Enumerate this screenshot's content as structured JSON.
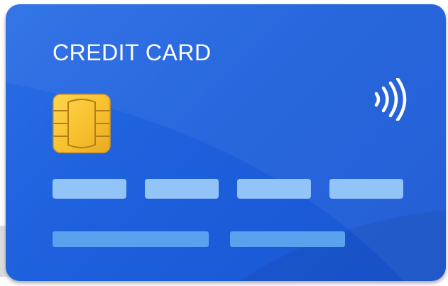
{
  "card": {
    "title": "CREDIT CARD",
    "colors": {
      "card_background": "#1d5fdc",
      "chip_gold": "#f6c33a",
      "number_bar": "#93c4f7",
      "detail_bar": "#5aa2ee",
      "text": "#ffffff"
    },
    "icons": {
      "contactless": "contactless-icon",
      "chip": "chip-icon"
    },
    "number_group_count": 4,
    "detail_line_count": 2
  }
}
